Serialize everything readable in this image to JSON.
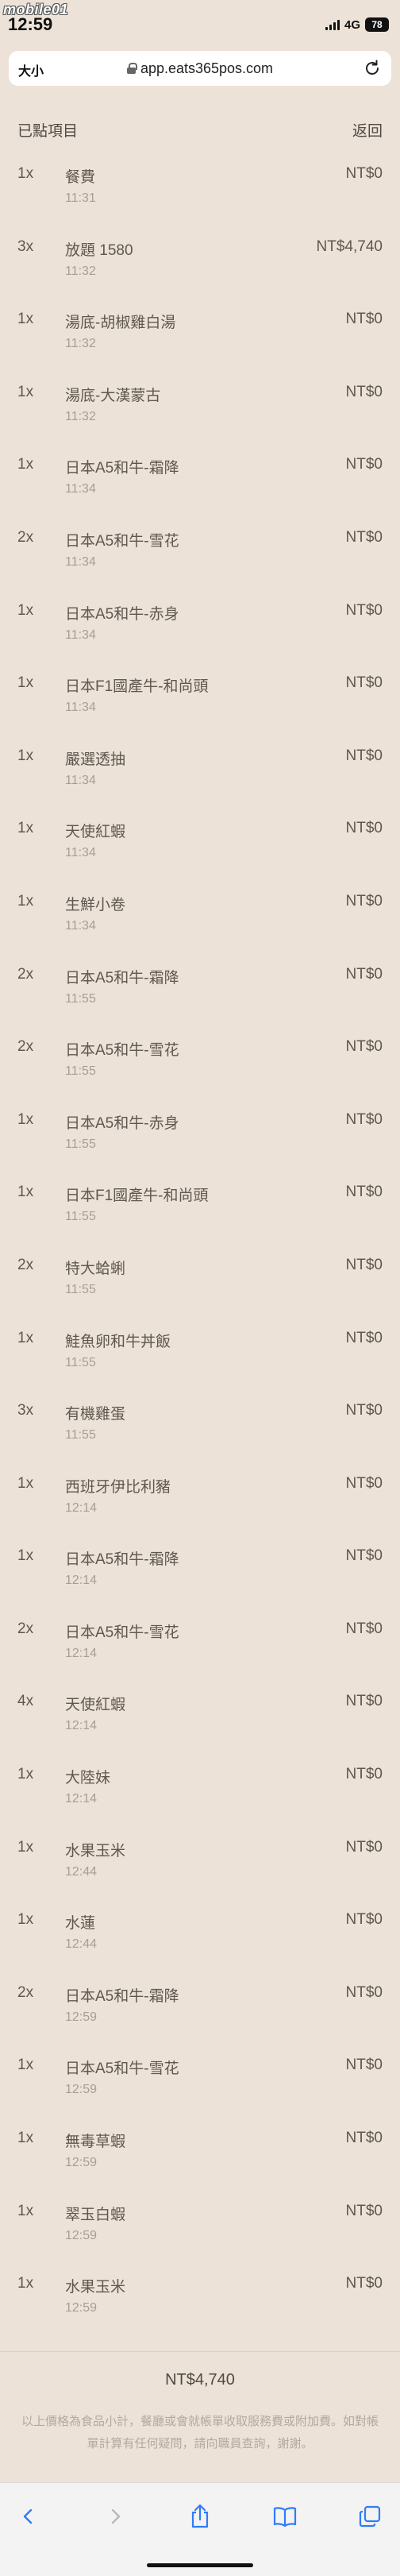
{
  "status_bar": {
    "time": "12:59",
    "watermark": "mobile01",
    "network": "4G",
    "battery": "78"
  },
  "browser": {
    "text_size": "大小",
    "url": "app.eats365pos.com"
  },
  "header": {
    "title": "已點項目",
    "back": "返回"
  },
  "orders": [
    {
      "qty": "1x",
      "name": "餐費",
      "time": "11:31",
      "price": "NT$0"
    },
    {
      "qty": "3x",
      "name": "放題 1580",
      "time": "11:32",
      "price": "NT$4,740"
    },
    {
      "qty": "1x",
      "name": "湯底-胡椒雞白湯",
      "time": "11:32",
      "price": "NT$0"
    },
    {
      "qty": "1x",
      "name": "湯底-大漢蒙古",
      "time": "11:32",
      "price": "NT$0"
    },
    {
      "qty": "1x",
      "name": "日本A5和牛-霜降",
      "time": "11:34",
      "price": "NT$0"
    },
    {
      "qty": "2x",
      "name": "日本A5和牛-雪花",
      "time": "11:34",
      "price": "NT$0"
    },
    {
      "qty": "1x",
      "name": "日本A5和牛-赤身",
      "time": "11:34",
      "price": "NT$0"
    },
    {
      "qty": "1x",
      "name": "日本F1國產牛-和尚頭",
      "time": "11:34",
      "price": "NT$0"
    },
    {
      "qty": "1x",
      "name": "嚴選透抽",
      "time": "11:34",
      "price": "NT$0"
    },
    {
      "qty": "1x",
      "name": "天使紅蝦",
      "time": "11:34",
      "price": "NT$0"
    },
    {
      "qty": "1x",
      "name": "生鮮小卷",
      "time": "11:34",
      "price": "NT$0"
    },
    {
      "qty": "2x",
      "name": "日本A5和牛-霜降",
      "time": "11:55",
      "price": "NT$0"
    },
    {
      "qty": "2x",
      "name": "日本A5和牛-雪花",
      "time": "11:55",
      "price": "NT$0"
    },
    {
      "qty": "1x",
      "name": "日本A5和牛-赤身",
      "time": "11:55",
      "price": "NT$0"
    },
    {
      "qty": "1x",
      "name": "日本F1國產牛-和尚頭",
      "time": "11:55",
      "price": "NT$0"
    },
    {
      "qty": "2x",
      "name": "特大蛤蜊",
      "time": "11:55",
      "price": "NT$0"
    },
    {
      "qty": "1x",
      "name": "鮭魚卵和牛丼飯",
      "time": "11:55",
      "price": "NT$0"
    },
    {
      "qty": "3x",
      "name": "有機雞蛋",
      "time": "11:55",
      "price": "NT$0"
    },
    {
      "qty": "1x",
      "name": "西班牙伊比利豬",
      "time": "12:14",
      "price": "NT$0"
    },
    {
      "qty": "1x",
      "name": "日本A5和牛-霜降",
      "time": "12:14",
      "price": "NT$0"
    },
    {
      "qty": "2x",
      "name": "日本A5和牛-雪花",
      "time": "12:14",
      "price": "NT$0"
    },
    {
      "qty": "4x",
      "name": "天使紅蝦",
      "time": "12:14",
      "price": "NT$0"
    },
    {
      "qty": "1x",
      "name": "大陸妹",
      "time": "12:14",
      "price": "NT$0"
    },
    {
      "qty": "1x",
      "name": "水果玉米",
      "time": "12:44",
      "price": "NT$0"
    },
    {
      "qty": "1x",
      "name": "水蓮",
      "time": "12:44",
      "price": "NT$0"
    },
    {
      "qty": "2x",
      "name": "日本A5和牛-霜降",
      "time": "12:59",
      "price": "NT$0"
    },
    {
      "qty": "1x",
      "name": "日本A5和牛-雪花",
      "time": "12:59",
      "price": "NT$0"
    },
    {
      "qty": "1x",
      "name": "無毒草蝦",
      "time": "12:59",
      "price": "NT$0"
    },
    {
      "qty": "1x",
      "name": "翠玉白蝦",
      "time": "12:59",
      "price": "NT$0"
    },
    {
      "qty": "1x",
      "name": "水果玉米",
      "time": "12:59",
      "price": "NT$0"
    }
  ],
  "summary": {
    "total": "NT$4,740",
    "note": "以上價格為食品小計，餐廳或會就帳單收取服務費或附加費。如對帳單計算有任何疑問，請向職員查詢，謝謝。"
  },
  "colors": {
    "background": "#ece2d7",
    "text": "#5f5850",
    "muted_text": "#a89f93"
  },
  "toolbar_icons": [
    "back-icon",
    "forward-icon",
    "share-icon",
    "bookmarks-icon",
    "tabs-icon"
  ]
}
